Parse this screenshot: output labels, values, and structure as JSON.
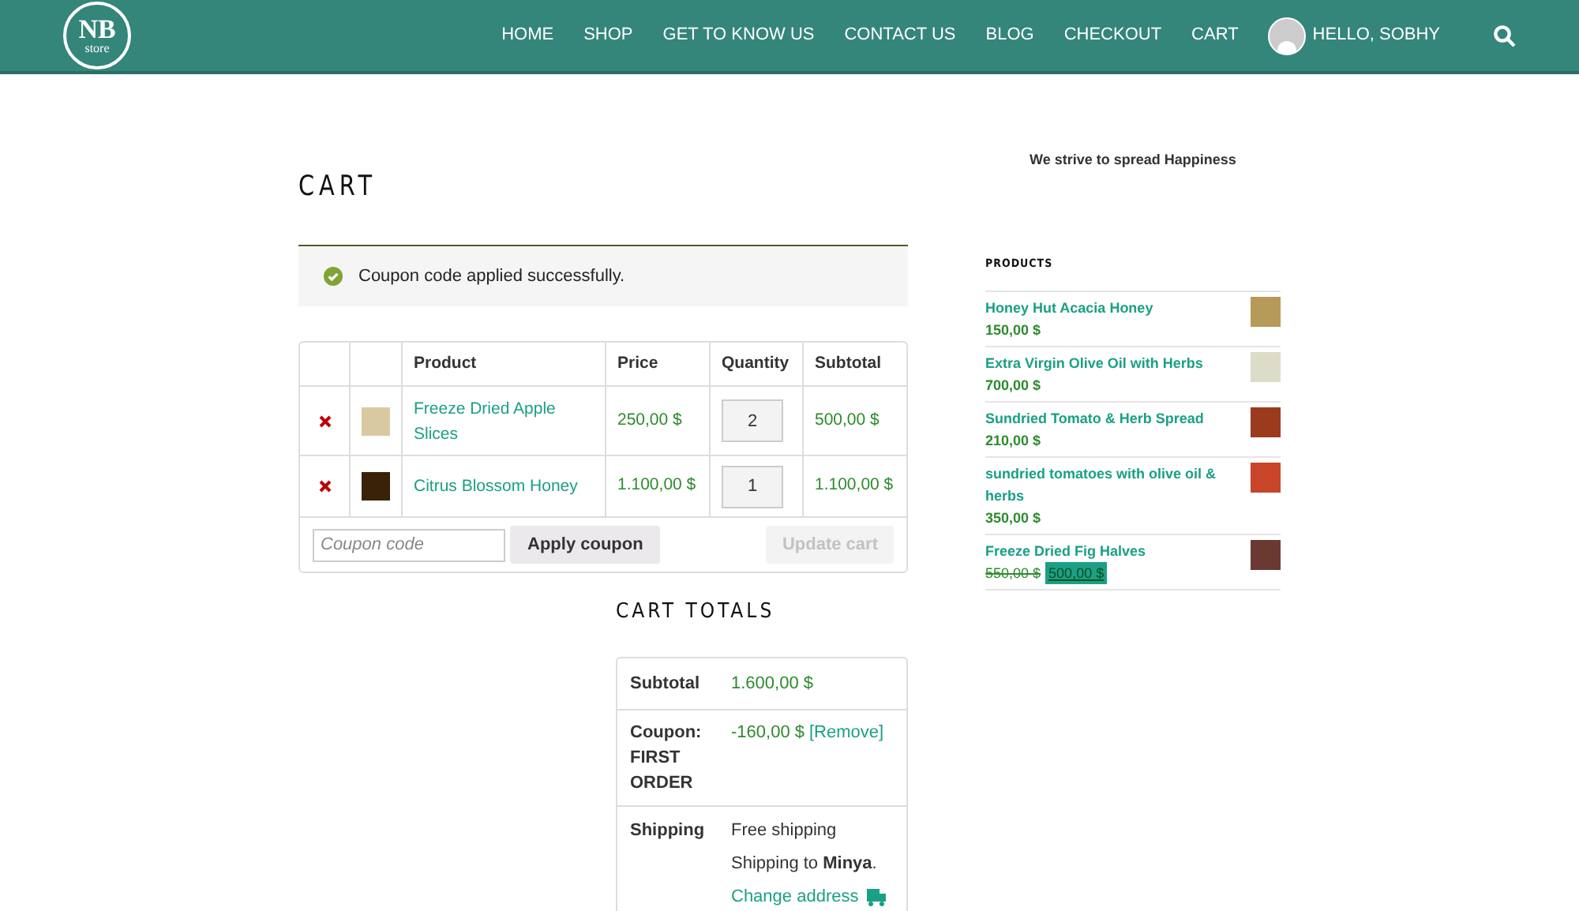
{
  "header": {
    "logo": {
      "main": "NB",
      "sub": "store"
    },
    "nav": [
      "HOME",
      "SHOP",
      "GET TO KNOW US",
      "CONTACT US",
      "BLOG",
      "CHECKOUT",
      "CART"
    ],
    "user": "HELLO, SOBHY"
  },
  "page_title": "CART",
  "notice": "Coupon code applied successfully.",
  "cart_table": {
    "columns": [
      "Product",
      "Price",
      "Quantity",
      "Subtotal"
    ],
    "rows": [
      {
        "product": "Freeze Dried Apple Slices",
        "price": "250,00 $",
        "quantity": "2",
        "subtotal": "500,00 $"
      },
      {
        "product": "Citrus Blossom Honey",
        "price": "1.100,00 $",
        "quantity": "1",
        "subtotal": "1.100,00 $"
      }
    ],
    "coupon_placeholder": "Coupon code",
    "apply_button": "Apply coupon",
    "update_button": "Update cart",
    "update_disabled": true
  },
  "cart_totals": {
    "title": "CART TOTALS",
    "subtotal_label": "Subtotal",
    "subtotal": "1.600,00 $",
    "coupon_label": "Coupon: FIRST ORDER",
    "coupon_value": "-160,00 $",
    "remove_link": "[Remove]",
    "shipping_label": "Shipping",
    "shipping_method": "Free shipping",
    "shipping_to": "Shipping to **Minya**.",
    "change_address": "Change address"
  },
  "sidebar": {
    "tagline": "We strive to spread Happiness",
    "heading": "PRODUCTS",
    "products": [
      {
        "kind": "regular",
        "name": "Honey Hut Acacia Honey",
        "price": "150,00 $"
      },
      {
        "kind": "regular",
        "name": "Extra Virgin Olive Oil with Herbs",
        "price": "700,00 $"
      },
      {
        "kind": "regular",
        "name": "Sundried Tomato & Herb Spread",
        "price": "210,00 $"
      },
      {
        "kind": "regular",
        "name": "sundried tomatoes with olive oil & herbs",
        "price": "350,00 $"
      },
      {
        "kind": "sale",
        "name": "Freeze Dried Fig Halves",
        "price": "550,00 $",
        "sale_price": "500,00 $"
      }
    ]
  }
}
